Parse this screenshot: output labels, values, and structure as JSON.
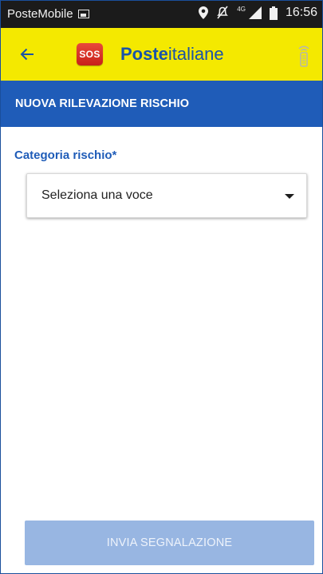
{
  "status_bar": {
    "carrier": "PosteMobile",
    "network": "4G",
    "time": "16:56",
    "icons": [
      "gallery-icon",
      "location-pin-icon",
      "mute-icon",
      "signal-icon",
      "battery-icon"
    ]
  },
  "toolbar": {
    "back_icon": "arrow-left-icon",
    "sos_label": "SOS",
    "brand_bold": "Poste",
    "brand_regular": "italiane",
    "beacon_icon": "beacon-icon"
  },
  "page": {
    "title": "NUOVA RILEVAZIONE RISCHIO"
  },
  "form": {
    "category_label": "Categoria rischio*",
    "category_value": "Seleziona una voce",
    "caret_icon": "caret-down-icon"
  },
  "actions": {
    "submit_label": "INVIA SEGNALAZIONE",
    "submit_enabled": false
  },
  "colors": {
    "toolbar_bg": "#f4e900",
    "title_bar_bg": "#1f5cb8",
    "brand_blue": "#1a53a8",
    "submit_disabled_bg": "#98b6e2",
    "status_bar_bg": "#1b1b1b"
  }
}
